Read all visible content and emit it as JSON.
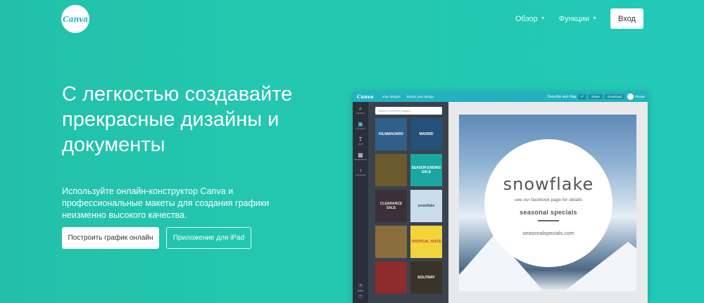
{
  "header": {
    "logo_text": "Canva",
    "nav": [
      {
        "label": "Обзор"
      },
      {
        "label": "Функции"
      }
    ],
    "login_label": "Вход"
  },
  "hero": {
    "title": "С легкостью создавайте прекрасные дизайны и документы",
    "subtitle": "Используйте онлайн-конструктор Canva и профессиональные макеты для создания графики неизменно высокого качества.",
    "primary_button": "Построить график онлайн",
    "secondary_button": "Приложение для iPad"
  },
  "editor": {
    "logo": "Canva",
    "top_links": [
      "Your designs",
      "Resize your design"
    ],
    "top_right": {
      "title": "Describe and #tag",
      "buttons": [
        "Share",
        "Download"
      ],
      "privacy": "Private"
    },
    "sidebar": [
      {
        "label": "SEARCH",
        "icon": "search-icon"
      },
      {
        "label": "LAYOUTS",
        "icon": "layouts-icon"
      },
      {
        "label": "TEXT",
        "icon": "text-icon"
      },
      {
        "label": "BKGROUND",
        "icon": "background-icon"
      },
      {
        "label": "UPLOADS",
        "icon": "upload-icon"
      }
    ],
    "zoom": "100%",
    "search_placeholder": "Search 1,000,000 images...",
    "thumbnails": [
      {
        "text": "KILIMANJARO",
        "bg": "#2f5f8a",
        "color": "#fff"
      },
      {
        "text": "MADRID",
        "bg": "#24507a",
        "color": "#fff"
      },
      {
        "text": "",
        "bg": "#6b5a2d",
        "color": "#fff"
      },
      {
        "text": "SEASON ENDING SALE",
        "bg": "#1aa7a0",
        "color": "#fff"
      },
      {
        "text": "CLEARANCE SALE",
        "bg": "#3b2f3a",
        "color": "#f5e6d0"
      },
      {
        "text": "snowflake",
        "bg": "#c8dcec",
        "color": "#355"
      },
      {
        "text": "",
        "bg": "#8a6e3d",
        "color": "#fff"
      },
      {
        "text": "TROPICAL TASTE",
        "bg": "#f2d43c",
        "color": "#c2452e"
      },
      {
        "text": "",
        "bg": "#8c2c2c",
        "color": "#fff"
      },
      {
        "text": "SOLITARY",
        "bg": "#3a3328",
        "color": "#fff"
      }
    ],
    "design": {
      "title": "snowflake",
      "subtitle": "see our facebook page for details",
      "specials": "seasonal specials",
      "url": "seasonalspecials.com"
    }
  }
}
